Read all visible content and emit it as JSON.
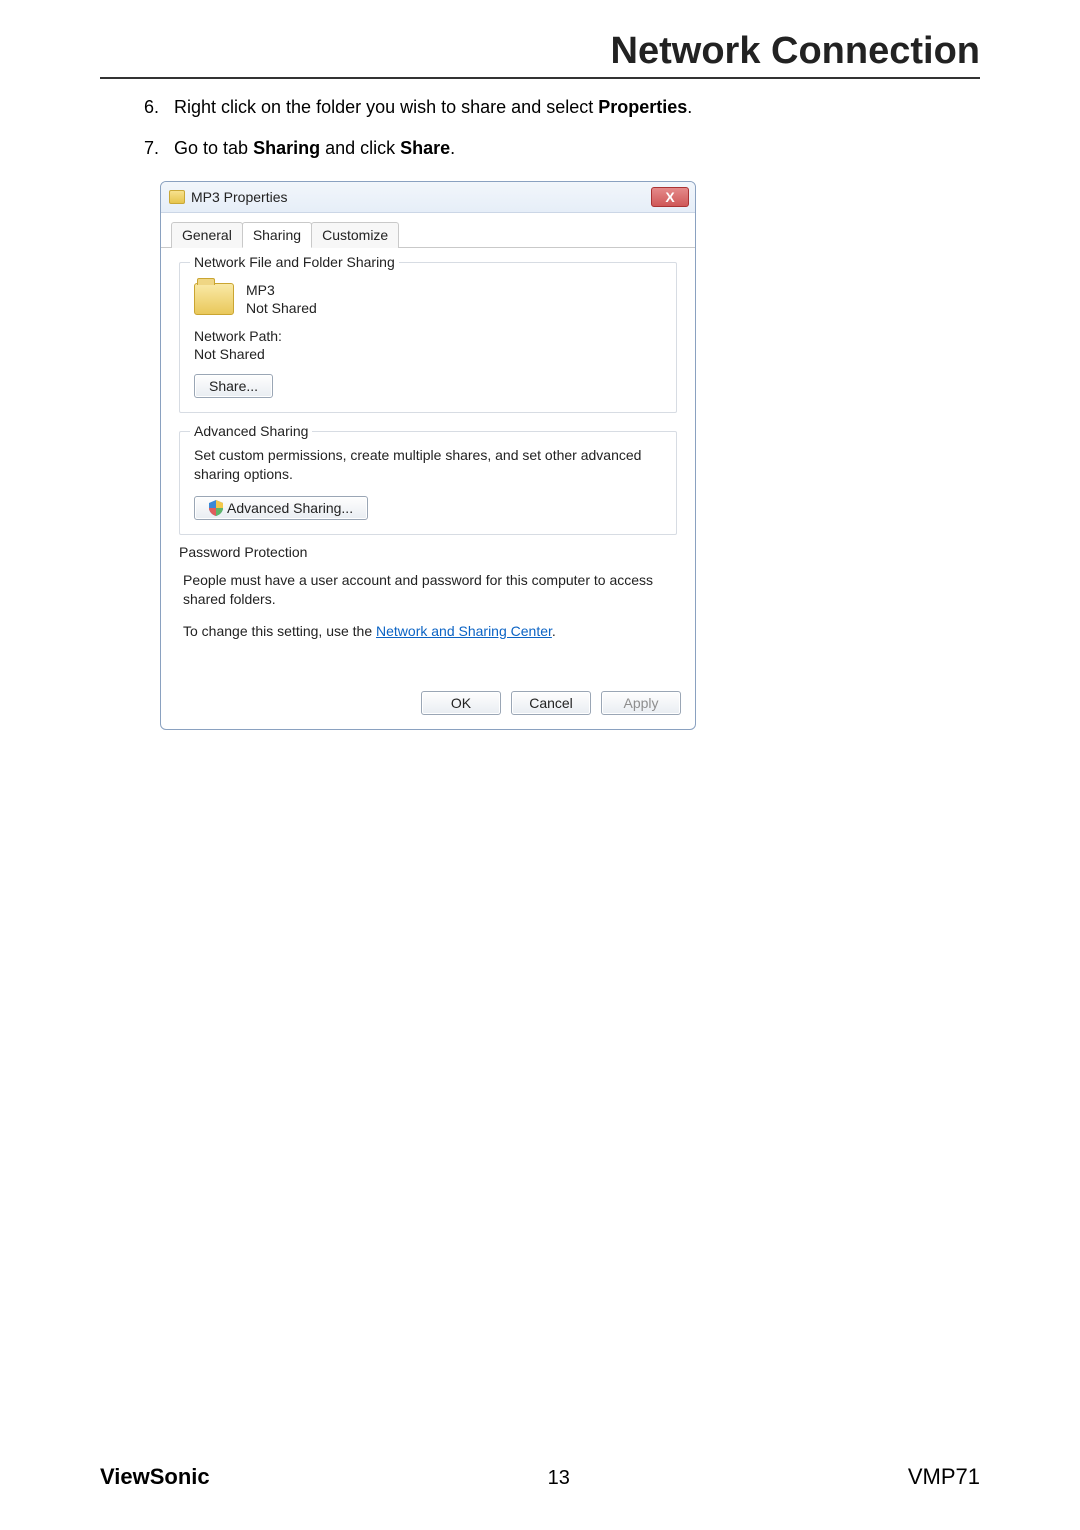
{
  "header": {
    "title": "Network Connection"
  },
  "instructions": {
    "step6": {
      "num": "6.",
      "text_a": "Right click on the folder you wish to share and select ",
      "bold_a": "Properties",
      "tail_a": "."
    },
    "step7": {
      "num": "7.",
      "text_a": "Go to tab ",
      "bold_a": "Sharing",
      "mid": " and click ",
      "bold_b": "Share",
      "tail": "."
    }
  },
  "dialog": {
    "title": "MP3 Properties",
    "close_glyph": "X",
    "tabs": {
      "general": "General",
      "sharing": "Sharing",
      "customize": "Customize"
    },
    "group_network": {
      "title": "Network File and Folder Sharing",
      "folder_name": "MP3",
      "folder_status": "Not Shared",
      "path_label": "Network Path:",
      "path_value": "Not Shared",
      "share_btn": "Share..."
    },
    "group_advanced": {
      "title": "Advanced Sharing",
      "desc": "Set custom permissions, create multiple shares, and set other advanced sharing options.",
      "btn": "Advanced Sharing..."
    },
    "group_password": {
      "title": "Password Protection",
      "desc": "People must have a user account and password for this computer to access shared folders.",
      "change_prefix": "To change this setting, use the ",
      "link": "Network and Sharing Center",
      "change_suffix": "."
    },
    "buttons": {
      "ok": "OK",
      "cancel": "Cancel",
      "apply": "Apply"
    }
  },
  "footer": {
    "brand": "ViewSonic",
    "page": "13",
    "model": "VMP71"
  }
}
